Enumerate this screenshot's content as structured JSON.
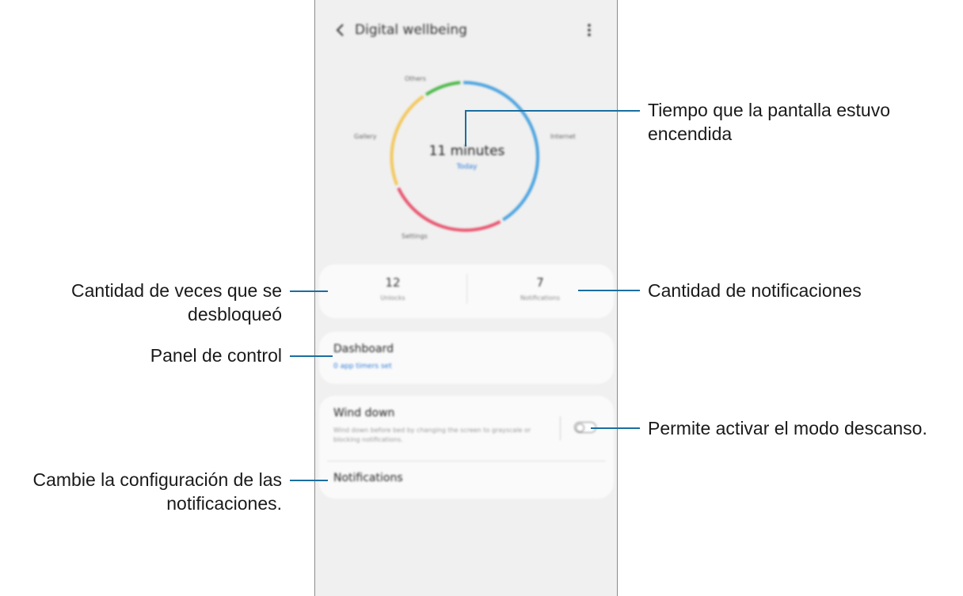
{
  "screen": {
    "title": "Digital wellbeing",
    "ring_labels": {
      "top": "Others",
      "left": "Gallery",
      "right": "Internet",
      "bottom": "Settings"
    },
    "total_time": "11 minutes",
    "today_label": "Today",
    "unlocks": {
      "value": "12",
      "label": "Unlocks"
    },
    "notifications": {
      "value": "7",
      "label": "Notifications"
    },
    "dashboard": {
      "title": "Dashboard",
      "subtitle": "0 app timers set"
    },
    "wind_down": {
      "title": "Wind down",
      "description": "Wind down before bed by changing the screen to grayscale or blocking notifications.",
      "toggle_on": false
    },
    "notifications_item": "Notifications"
  },
  "ring_colors": {
    "blue": "#4aa3df",
    "red": "#e8546e",
    "yellow": "#f2c75c",
    "green": "#4cb848"
  },
  "callouts": {
    "screen_time_line1": "Tiempo que la pantalla estuvo",
    "screen_time_line2": "encendida",
    "notif_count": "Cantidad de notificaciones",
    "unlock_line1": "Cantidad de veces que se",
    "unlock_line2": "desbloqueó",
    "dashboard": "Panel de control",
    "wind_down": "Permite activar el modo descanso.",
    "notif_settings_line1": "Cambie la configuración de las",
    "notif_settings_line2": "notificaciones."
  }
}
